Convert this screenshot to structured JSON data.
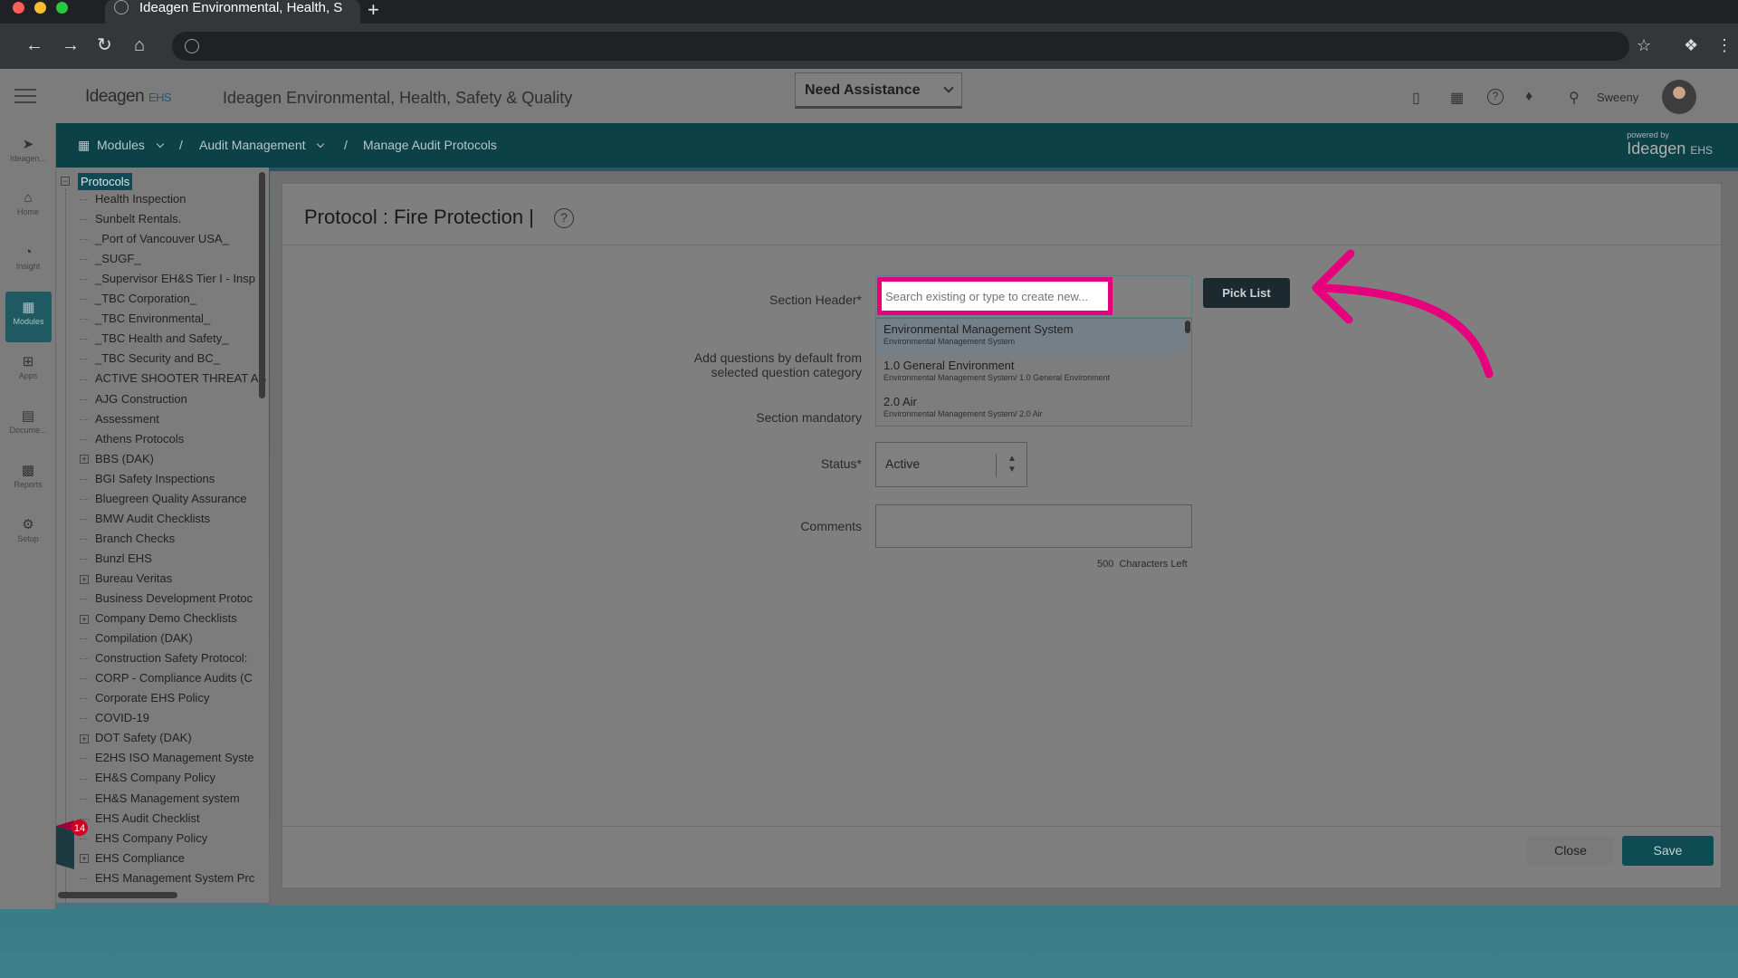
{
  "browser": {
    "tab_title": "Ideagen Environmental, Health, S",
    "new_tab_icon": "plus-icon",
    "nav_icons": [
      "back-icon",
      "forward-icon",
      "reload-icon",
      "home-icon"
    ],
    "colors": {
      "close": "#ff5f57",
      "minimize": "#febc2e",
      "zoom": "#28c840"
    }
  },
  "header": {
    "logo_text": "Ideagen",
    "logo_suffix": "EHS",
    "app_title": "Ideagen Environmental, Health, Safety & Quality",
    "need_assistance": "Need Assistance",
    "user_name": "Sweeny",
    "icons": [
      "mobile-icon",
      "calendar-icon",
      "help-icon",
      "bell-icon",
      "location-icon"
    ]
  },
  "breadcrumb": {
    "items": [
      "Modules",
      "Audit Management",
      "Manage Audit Protocols"
    ],
    "powered_by": "powered by",
    "powered_logo": "Ideagen",
    "powered_suffix": "EHS"
  },
  "rail": {
    "items": [
      {
        "label": "Ideagen...",
        "icon": "ideagen-icon"
      },
      {
        "label": "Home",
        "icon": "home-icon"
      },
      {
        "label": "Insight",
        "icon": "insight-icon"
      },
      {
        "label": "Modules",
        "icon": "modules-icon",
        "active": true
      },
      {
        "label": "Apps",
        "icon": "apps-icon"
      },
      {
        "label": "Docume...",
        "icon": "document-icon"
      },
      {
        "label": "Reports",
        "icon": "reports-icon"
      },
      {
        "label": "Setup",
        "icon": "gear-icon"
      }
    ]
  },
  "tree": {
    "root": "Protocols",
    "items": [
      {
        "label": "Health Inspection",
        "expandable": false
      },
      {
        "label": "Sunbelt Rentals.",
        "expandable": false
      },
      {
        "label": "_Port of Vancouver USA_",
        "expandable": false
      },
      {
        "label": "_SUGF_",
        "expandable": false
      },
      {
        "label": "_Supervisor EH&S Tier I - Insp",
        "expandable": false
      },
      {
        "label": "_TBC Corporation_",
        "expandable": false
      },
      {
        "label": "_TBC Environmental_",
        "expandable": false
      },
      {
        "label": "_TBC Health and Safety_",
        "expandable": false
      },
      {
        "label": "_TBC Security and BC_",
        "expandable": false
      },
      {
        "label": "ACTIVE SHOOTER THREAT AS",
        "expandable": false
      },
      {
        "label": "AJG Construction",
        "expandable": false
      },
      {
        "label": "Assessment",
        "expandable": false
      },
      {
        "label": "Athens Protocols",
        "expandable": false
      },
      {
        "label": "BBS (DAK)",
        "expandable": true
      },
      {
        "label": "BGI Safety Inspections",
        "expandable": false
      },
      {
        "label": "Bluegreen Quality Assurance",
        "expandable": false
      },
      {
        "label": "BMW Audit Checklists",
        "expandable": false
      },
      {
        "label": "Branch Checks",
        "expandable": false
      },
      {
        "label": "Bunzl EHS",
        "expandable": false
      },
      {
        "label": "Bureau Veritas",
        "expandable": true
      },
      {
        "label": "Business Development Protoc",
        "expandable": false
      },
      {
        "label": "Company Demo Checklists",
        "expandable": true
      },
      {
        "label": "Compilation (DAK)",
        "expandable": false
      },
      {
        "label": "Construction Safety Protocol:",
        "expandable": false
      },
      {
        "label": "CORP - Compliance Audits (C",
        "expandable": false
      },
      {
        "label": "Corporate EHS Policy",
        "expandable": false
      },
      {
        "label": "COVID-19",
        "expandable": false
      },
      {
        "label": "DOT Safety (DAK)",
        "expandable": true
      },
      {
        "label": "E2HS ISO Management Syste",
        "expandable": false
      },
      {
        "label": "EH&S Company Policy",
        "expandable": false
      },
      {
        "label": "EH&S Management system",
        "expandable": false
      },
      {
        "label": "EHS Audit Checklist",
        "expandable": false
      },
      {
        "label": "EHS Company Policy",
        "expandable": false
      },
      {
        "label": "EHS Compliance",
        "expandable": true
      },
      {
        "label": "EHS Management System Prc",
        "expandable": false
      }
    ],
    "notification_count": "14"
  },
  "modal": {
    "title": "Protocol : Fire Protection |",
    "labels": {
      "section_header": "Section Header",
      "required_mark": "*",
      "add_questions_line1": "Add questions by default from",
      "add_questions_line2": "selected question category",
      "section_mandatory": "Section mandatory",
      "status": "Status",
      "comments": "Comments"
    },
    "section_header_placeholder": "Search existing or type to create new...",
    "dropdown": [
      {
        "main": "Environmental Management System",
        "sub": "Environmental Management System",
        "selected": true
      },
      {
        "main": "1.0 General Environment",
        "sub": "Environmental Management System/ 1.0 General Environment",
        "selected": false
      },
      {
        "main": "2.0 Air",
        "sub": "Environmental Management System/ 2.0 Air",
        "selected": false
      }
    ],
    "pick_list": "Pick List",
    "status_value": "Active",
    "chars_count": "500",
    "chars_label": "Characters Left",
    "close": "Close",
    "save": "Save"
  },
  "annotation": {
    "highlight_color": "#e6007e"
  }
}
